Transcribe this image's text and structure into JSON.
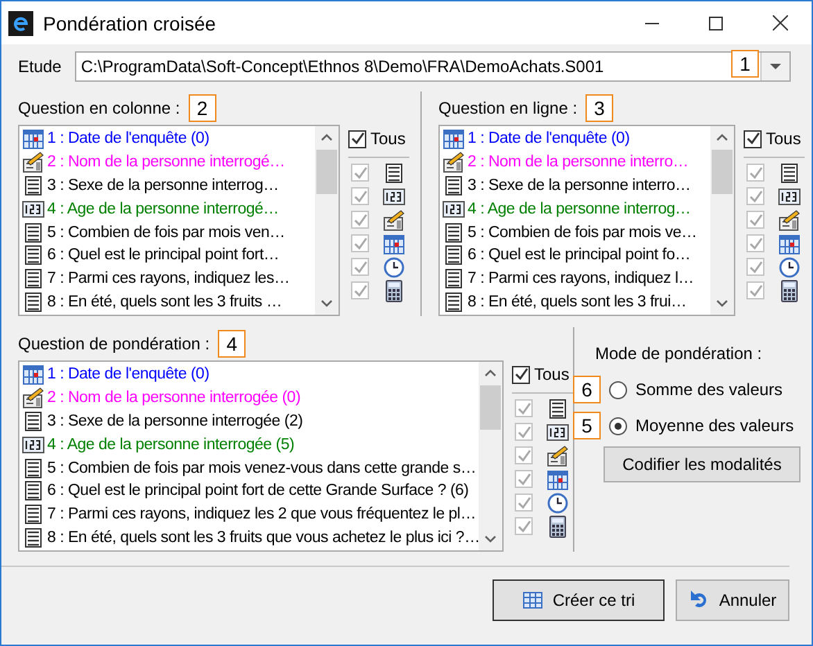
{
  "window": {
    "title": "Pondération croisée"
  },
  "study": {
    "label": "Etude",
    "value": "C:\\ProgramData\\Soft-Concept\\Ethnos 8\\Demo\\FRA\\DemoAchats.S001",
    "badge": "1"
  },
  "panels": [
    {
      "label": "Question en colonne :",
      "badge": "2",
      "all": {
        "label": "Tous",
        "checked": true
      },
      "questions": [
        {
          "kind": "calendar",
          "color": "#0000ff",
          "text": "1 : Date de l'enquête (0)",
          "selected": false
        },
        {
          "kind": "edit",
          "color": "#ff00ff",
          "text": "2 : Nom de la personne interrogé…",
          "selected": false
        },
        {
          "kind": "list",
          "color": "#000000",
          "text": "3 : Sexe de la personne interrog…",
          "selected": false
        },
        {
          "kind": "numeric",
          "color": "#008000",
          "text": "4 : Age de la personne interrogé…",
          "selected": false
        },
        {
          "kind": "list",
          "color": "#000000",
          "text": "5 : Combien de fois par mois ven…",
          "selected": false
        },
        {
          "kind": "list",
          "color": "#000000",
          "text": "6 : Quel est le principal point fort…",
          "selected": false
        },
        {
          "kind": "list",
          "color": "#000000",
          "text": "7 : Parmi ces rayons, indiquez les…",
          "selected": false
        },
        {
          "kind": "list",
          "color": "#000000",
          "text": "8 : En été, quels sont les 3 fruits …",
          "selected": false
        }
      ],
      "filters": [
        {
          "kind": "list",
          "checked": true,
          "disabled": true
        },
        {
          "kind": "numeric",
          "checked": true,
          "disabled": true
        },
        {
          "kind": "edit",
          "checked": true,
          "disabled": true
        },
        {
          "kind": "calendar",
          "checked": true,
          "disabled": true
        },
        {
          "kind": "clock",
          "checked": true,
          "disabled": true
        },
        {
          "kind": "calculator",
          "checked": true,
          "disabled": true
        }
      ]
    },
    {
      "label": "Question en ligne :",
      "badge": "3",
      "all": {
        "label": "Tous",
        "checked": true
      },
      "questions": [
        {
          "kind": "calendar",
          "color": "#0000ff",
          "text": "1 : Date de l'enquête (0)",
          "selected": false
        },
        {
          "kind": "edit",
          "color": "#ff00ff",
          "text": "2 : Nom de la personne interro…",
          "selected": false
        },
        {
          "kind": "list",
          "color": "#000000",
          "text": "3 : Sexe de la personne interro…",
          "selected": false
        },
        {
          "kind": "numeric",
          "color": "#008000",
          "text": "4 : Age de la personne interrog…",
          "selected": false
        },
        {
          "kind": "list",
          "color": "#000000",
          "text": "5 : Combien de fois par mois ve…",
          "selected": false
        },
        {
          "kind": "list",
          "color": "#000000",
          "text": "6 : Quel est le principal point fo…",
          "selected": false
        },
        {
          "kind": "list",
          "color": "#000000",
          "text": "7 : Parmi ces rayons, indiquez l…",
          "selected": false
        },
        {
          "kind": "list",
          "color": "#000000",
          "text": "8 : En été, quels sont les 3 frui…",
          "selected": false
        }
      ],
      "filters": [
        {
          "kind": "list",
          "checked": true,
          "disabled": true
        },
        {
          "kind": "numeric",
          "checked": true,
          "disabled": true
        },
        {
          "kind": "edit",
          "checked": true,
          "disabled": true
        },
        {
          "kind": "calendar",
          "checked": true,
          "disabled": true
        },
        {
          "kind": "clock",
          "checked": true,
          "disabled": true
        },
        {
          "kind": "calculator",
          "checked": true,
          "disabled": true
        }
      ]
    },
    {
      "label": "Question de pondération :",
      "badge": "4",
      "all": {
        "label": "Tous",
        "checked": true
      },
      "questions": [
        {
          "kind": "calendar",
          "color": "#0000ff",
          "text": "1 : Date de l'enquête (0)",
          "selected": false
        },
        {
          "kind": "edit",
          "color": "#ff00ff",
          "text": "2 : Nom de la personne interrogée (0)",
          "selected": false
        },
        {
          "kind": "list",
          "color": "#000000",
          "text": "3 : Sexe de la personne interrogée (2)",
          "selected": false
        },
        {
          "kind": "numeric",
          "color": "#008000",
          "text": "4 : Age de la personne interrogée (5)",
          "selected": false
        },
        {
          "kind": "list",
          "color": "#000000",
          "text": "5 : Combien de fois par mois venez-vous dans cette grande s…",
          "selected": false
        },
        {
          "kind": "list",
          "color": "#000000",
          "text": "6 : Quel est le principal point fort de cette Grande Surface ? (6)",
          "selected": false
        },
        {
          "kind": "list",
          "color": "#000000",
          "text": "7 : Parmi ces rayons, indiquez les 2 que vous fréquentez le pl…",
          "selected": false
        },
        {
          "kind": "list",
          "color": "#000000",
          "text": "8 : En été, quels sont les 3 fruits que vous achetez le plus ici ?…",
          "selected": false
        }
      ],
      "filters": [
        {
          "kind": "list",
          "checked": true,
          "disabled": true
        },
        {
          "kind": "numeric",
          "checked": true,
          "disabled": true
        },
        {
          "kind": "edit",
          "checked": true,
          "disabled": true
        },
        {
          "kind": "calendar",
          "checked": true,
          "disabled": true
        },
        {
          "kind": "clock",
          "checked": true,
          "disabled": true
        },
        {
          "kind": "calculator",
          "checked": true,
          "disabled": true
        }
      ]
    }
  ],
  "mode": {
    "label": "Mode de pondération :",
    "options": [
      {
        "label": "Somme des valeurs",
        "badge": "6",
        "selected": false
      },
      {
        "label": "Moyenne des valeurs",
        "badge": "5",
        "selected": true
      }
    ]
  },
  "code_button": {
    "label": "Codifier les modalités"
  },
  "footer_buttons": [
    {
      "label": "Créer ce tri",
      "kind": "table",
      "default": true
    },
    {
      "label": "Annuler",
      "kind": "undo",
      "default": false
    }
  ]
}
